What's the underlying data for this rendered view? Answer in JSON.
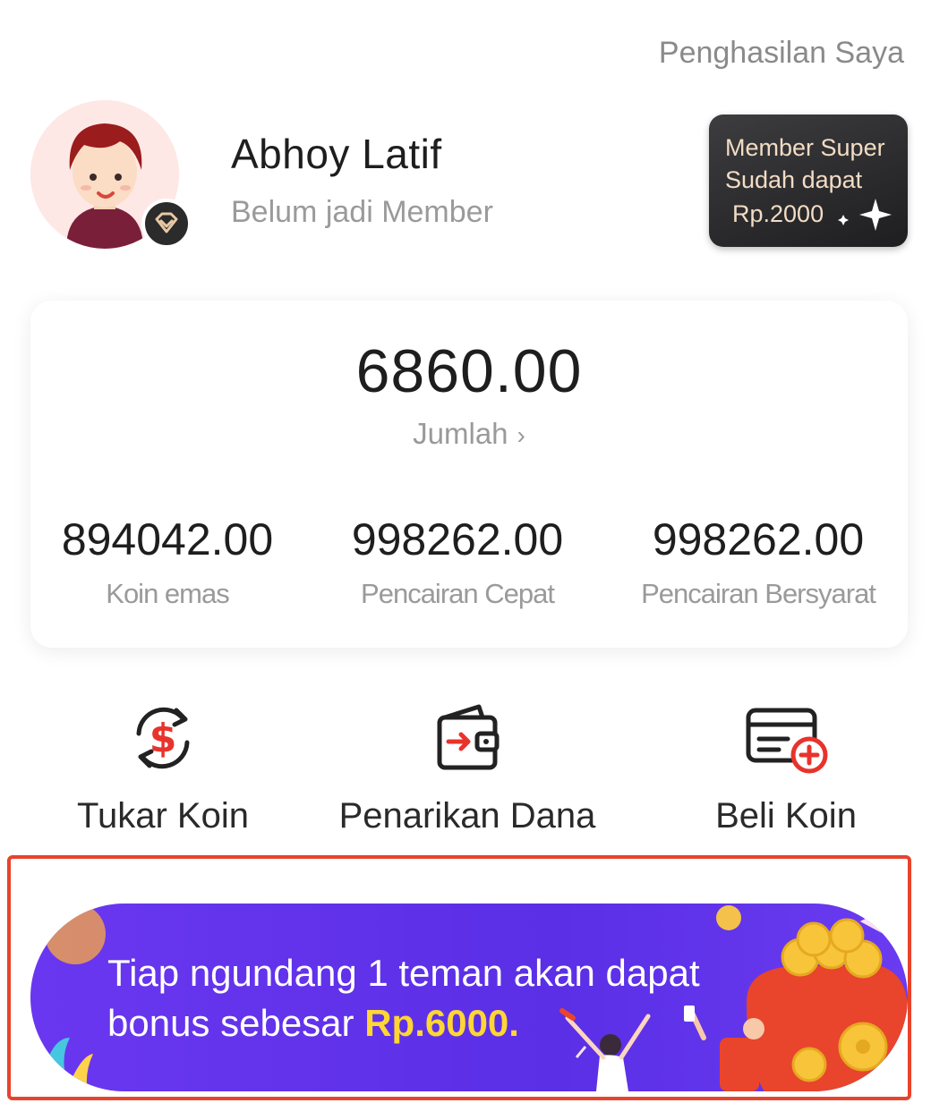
{
  "header": {
    "earnings_link": "Penghasilan Saya"
  },
  "profile": {
    "name": "Abhoy Latif",
    "member_status": "Belum jadi Member",
    "promo_card": {
      "line1": "Member Super",
      "line2": "Sudah dapat",
      "line3": "Rp.2000"
    }
  },
  "balance": {
    "total_amount": "6860.00",
    "total_label": "Jumlah",
    "stats": [
      {
        "value": "894042.00",
        "label": "Koin emas"
      },
      {
        "value": "998262.00",
        "label": "Pencairan Cepat"
      },
      {
        "value": "998262.00",
        "label": "Pencairan Bersyarat"
      }
    ]
  },
  "actions": [
    {
      "label": "Tukar Koin",
      "icon": "exchange-dollar-icon"
    },
    {
      "label": "Penarikan Dana",
      "icon": "wallet-withdraw-icon"
    },
    {
      "label": "Beli Koin",
      "icon": "card-add-icon"
    }
  ],
  "banner": {
    "line1": "Tiap ngundang 1 teman akan dapat",
    "line2_prefix": "bonus sebesar ",
    "line2_amount": "Rp.6000."
  },
  "colors": {
    "accent_red": "#e8332c",
    "banner_purple": "#5e33ea",
    "banner_highlight": "#ffd633",
    "highlight_border": "#e8432c"
  }
}
